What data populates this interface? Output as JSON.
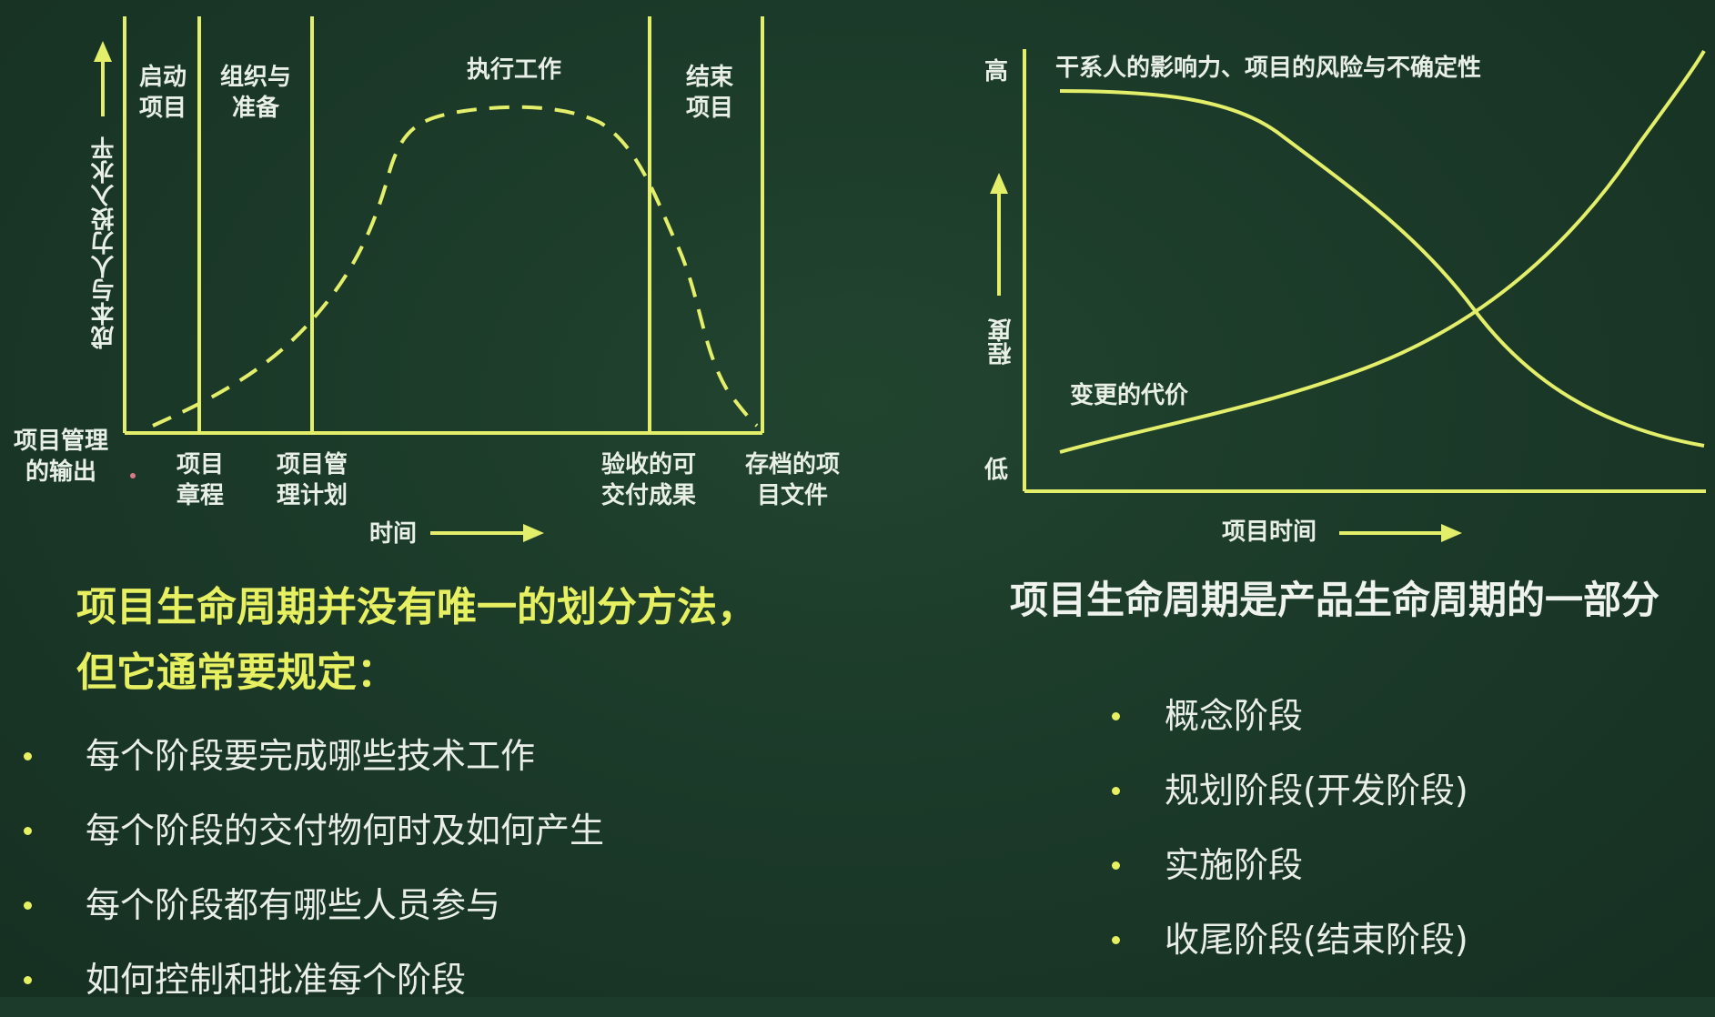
{
  "left_diagram": {
    "y_axis_label": "成本与人力投入水平",
    "x_axis_label": "时间",
    "phases": [
      "启动\n项目",
      "组织与\n准备",
      "执行工作",
      "结束\n项目"
    ],
    "output_label": "项目管理\n的输出",
    "outputs": [
      "项目\n章程",
      "项目管\n理计划",
      "验收的可\n交付成果",
      "存档的项\n目文件"
    ]
  },
  "right_diagram": {
    "y_high": "高",
    "y_low": "低",
    "y_axis_label": "程度",
    "x_axis_label": "项目时间",
    "curve_influence_label": "干系人的影响力、项目的风险与不确定性",
    "curve_change_cost_label": "变更的代价"
  },
  "left_text": {
    "heading_line1": "项目生命周期并没有唯一的划分方法，",
    "heading_line2": "但它通常要规定：",
    "bullets": [
      "每个阶段要完成哪些技术工作",
      "每个阶段的交付物何时及如何产生",
      "每个阶段都有哪些人员参与",
      "如何控制和批准每个阶段"
    ]
  },
  "right_text": {
    "heading": "项目生命周期是产品生命周期的一部分",
    "bullets": [
      "概念阶段",
      "规划阶段(开发阶段)",
      "实施阶段",
      "收尾阶段(结束阶段)"
    ]
  },
  "colors": {
    "background": "#1c3b2b",
    "line": "#e3ee6a",
    "heading": "#e6f060",
    "text": "#e9eee8"
  }
}
